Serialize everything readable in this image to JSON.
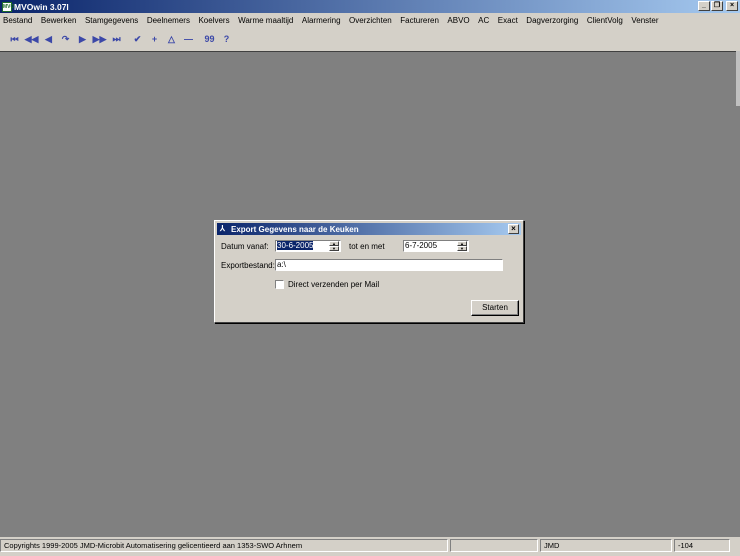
{
  "window": {
    "title": "MVOwin 3.07l",
    "icon_label": "MVO",
    "controls": {
      "minimize": "_",
      "restore": "❐",
      "close": "×"
    }
  },
  "menu": [
    "Bestand",
    "Bewerken",
    "Stamgegevens",
    "Deelnemers",
    "Koelvers",
    "Warme maaltijd",
    "Alarmering",
    "Overzichten",
    "Factureren",
    "ABVO",
    "AC",
    "Exact",
    "Dagverzorging",
    "ClientVolg",
    "Venster"
  ],
  "toolbar": {
    "first": "⏮",
    "prev_page": "◀◀",
    "prev": "◀",
    "redo": "↷",
    "next": "▶",
    "next_page": "▶▶",
    "last": "⏭",
    "confirm": "✔",
    "add": "+",
    "toggle": "△",
    "remove": "—",
    "quote": "99",
    "help": "?"
  },
  "dialog": {
    "title": "Export Gegevens naar de Keuken",
    "icon": "⅄",
    "close": "×",
    "date_from_label": "Datum vanaf:",
    "date_from_value": "30-6-2005",
    "date_to_label": "tot en met",
    "date_to_value": "6-7-2005",
    "export_label": "Exportbestand:",
    "export_value": "a:\\",
    "mail_label": "Direct verzenden per Mail",
    "start_label": "Starten"
  },
  "status": {
    "copyright": "Copyrights 1999-2005 JMD-Microbit Automatisering gelicentieerd aan 1353-SWO Arhnem",
    "user": "JMD",
    "code": "-104"
  }
}
